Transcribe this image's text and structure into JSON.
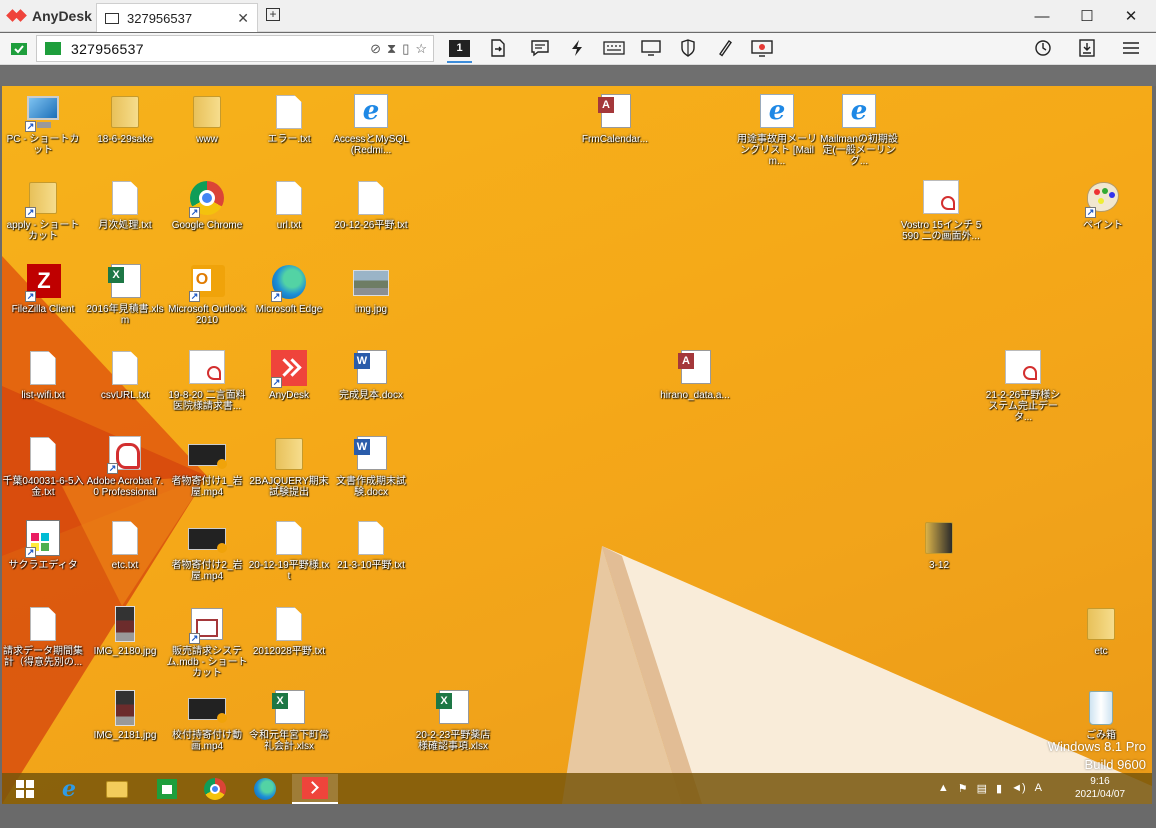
{
  "app": {
    "name": "AnyDesk"
  },
  "tab": {
    "label": "327956537",
    "icon": "monitor-icon"
  },
  "window": {
    "minimize": "—",
    "maximize": "☐",
    "close": "✕"
  },
  "toolbar": {
    "address_value": "327956537",
    "monitor_number": "1",
    "accent": "#ef443b"
  },
  "desktop": {
    "icons": [
      {
        "label": "PC - ショートカット",
        "type": "pc"
      },
      {
        "label": "18-6-29sake",
        "type": "folder"
      },
      {
        "label": "www",
        "type": "folder"
      },
      {
        "label": "エラー.txt",
        "type": "txt"
      },
      {
        "label": "AccessとMySQL(Redmi...",
        "type": "ie"
      },
      {
        "label": "FrmCalendar...",
        "type": "access"
      },
      {
        "label": "用途事故用メーリングリスト [Mailm...",
        "type": "ie"
      },
      {
        "label": "Mailmanの初期設定(一般メーリング...",
        "type": "ie"
      },
      {
        "label": "apply - ショートカット",
        "type": "folder"
      },
      {
        "label": "月次処理.txt",
        "type": "txt"
      },
      {
        "label": "Google Chrome",
        "type": "chrome"
      },
      {
        "label": "url.txt",
        "type": "txt"
      },
      {
        "label": "20-12-26平野.txt",
        "type": "txt"
      },
      {
        "label": "Vostro 15インチ 5590 二の画面外...",
        "type": "pdf"
      },
      {
        "label": "ペイント",
        "type": "paint"
      },
      {
        "label": "FileZilla Client",
        "type": "filezilla"
      },
      {
        "label": "2016年見積書.xlsm",
        "type": "excel"
      },
      {
        "label": "Microsoft Outlook 2010",
        "type": "outlook"
      },
      {
        "label": "Microsoft Edge",
        "type": "edge"
      },
      {
        "label": "img.jpg",
        "type": "image"
      },
      {
        "label": "list-wifi.txt",
        "type": "txt"
      },
      {
        "label": "csvURL.txt",
        "type": "txt"
      },
      {
        "label": "19-8-20 二言面料医院様請求書...",
        "type": "pdf"
      },
      {
        "label": "AnyDesk",
        "type": "anydesk"
      },
      {
        "label": "完成見本.docx",
        "type": "word"
      },
      {
        "label": "hirano_data.a...",
        "type": "access"
      },
      {
        "label": "21-2-26平野様システム完止データ...",
        "type": "pdf"
      },
      {
        "label": "千葉040031-6-5入金.txt",
        "type": "txt"
      },
      {
        "label": "Adobe Acrobat 7.0 Professional",
        "type": "acrobat"
      },
      {
        "label": "者物寄付け1_岩屋.mp4",
        "type": "video"
      },
      {
        "label": "2BAJQUERY期末試験提出",
        "type": "folder"
      },
      {
        "label": "文書作成期末試験.docx",
        "type": "word"
      },
      {
        "label": "サクラエディタ",
        "type": "sakura"
      },
      {
        "label": "etc.txt",
        "type": "txt"
      },
      {
        "label": "者物寄付け2_岩屋.mp4",
        "type": "video"
      },
      {
        "label": "20-12-19平野様.txt",
        "type": "txt"
      },
      {
        "label": "21-3-10平野.txt",
        "type": "txt"
      },
      {
        "label": "3-12",
        "type": "folder-dark"
      },
      {
        "label": "請求データ期間集計（得意先別の...",
        "type": "txt"
      },
      {
        "label": "IMG_2180.jpg",
        "type": "photo"
      },
      {
        "label": "販売請求システム.mdb - ショートカット",
        "type": "access-shared"
      },
      {
        "label": "2012028平野.txt",
        "type": "txt"
      },
      {
        "label": "etc",
        "type": "folder"
      },
      {
        "label": "IMG_2181.jpg",
        "type": "photo"
      },
      {
        "label": "校付持寄付け動画.mp4",
        "type": "video"
      },
      {
        "label": "令和元年宮下町常礼会計.xlsx",
        "type": "excel"
      },
      {
        "label": "20-2-23平野薬店様確認事項.xlsx",
        "type": "excel"
      },
      {
        "label": "ごみ箱",
        "type": "trash"
      }
    ],
    "watermark": {
      "line1": "Windows 8.1 Pro",
      "line2": "Build 9600"
    }
  },
  "taskbar": {
    "clock_time": "9:16",
    "clock_date": "2021/04/07",
    "tray_expand": "▲",
    "ime": "A"
  }
}
